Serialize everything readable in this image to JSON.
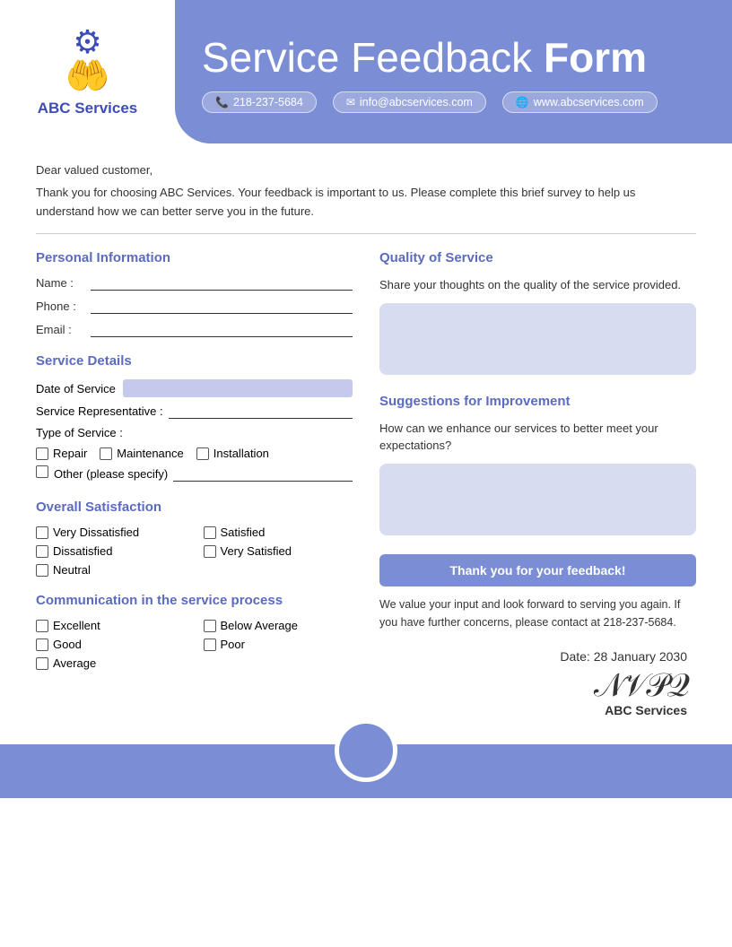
{
  "header": {
    "logo_text": "ABC Services",
    "title_light": "Service Feedback ",
    "title_bold": "Form",
    "contact": {
      "phone": "218-237-5684",
      "email": "info@abcservices.com",
      "website": "www.abcservices.com"
    }
  },
  "intro": {
    "line1": "Dear valued customer,",
    "line2": "Thank you for choosing ABC Services. Your feedback is important to us. Please complete this brief survey to help us understand how we can better serve you in the future."
  },
  "personal_info": {
    "title": "Personal Information",
    "name_label": "Name :",
    "phone_label": "Phone :",
    "email_label": "Email :"
  },
  "service_details": {
    "title": "Service Details",
    "date_label": "Date of Service",
    "rep_label": "Service Representative :",
    "type_label": "Type of Service :",
    "types": [
      "Repair",
      "Maintenance",
      "Installation"
    ],
    "other_label": "Other (please specify)"
  },
  "satisfaction": {
    "title": "Overall Satisfaction",
    "options": [
      "Very Dissatisfied",
      "Satisfied",
      "Dissatisfied",
      "Very Satisfied",
      "Neutral",
      ""
    ]
  },
  "communication": {
    "title": "Communication in the service process",
    "options": [
      "Excellent",
      "Below Average",
      "Good",
      "Poor",
      "Average",
      ""
    ]
  },
  "quality": {
    "title": "Quality of Service",
    "description": "Share your thoughts on the quality of the service provided."
  },
  "suggestions": {
    "title": "Suggestions for Improvement",
    "description": "How can we enhance our services to better meet your expectations?"
  },
  "thank_you": {
    "banner": "Thank you for your feedback!",
    "text": "We value your input and look forward to serving you again. If you have further concerns, please contact at 218-237-5684."
  },
  "signature": {
    "date_label": "Date: 28 January 2030",
    "name": "ABC Services"
  }
}
